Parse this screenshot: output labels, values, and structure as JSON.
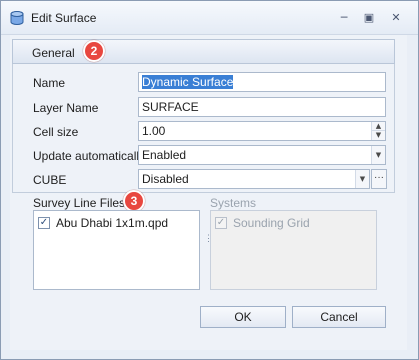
{
  "window": {
    "title": "Edit Surface",
    "controls": {
      "minimize": "─",
      "maximize": "▣",
      "close": "✕"
    }
  },
  "general": {
    "header": "General",
    "badge": "2",
    "fields": {
      "name": {
        "label": "Name",
        "value": "Dynamic Surface"
      },
      "layer_name": {
        "label": "Layer Name",
        "value": "SURFACE"
      },
      "cell_size": {
        "label": "Cell size",
        "value": "1.00"
      },
      "update_automatically": {
        "label": "Update automatically",
        "value": "Enabled"
      },
      "cube": {
        "label": "CUBE",
        "value": "Disabled",
        "ellipsis": "···"
      }
    }
  },
  "survey_line_files": {
    "title": "Survey Line Files",
    "badge": "3",
    "items": [
      {
        "label": "Abu Dhabi 1x1m.qpd",
        "checked": true
      }
    ]
  },
  "systems": {
    "title": "Systems",
    "items": [
      {
        "label": "Sounding Grid",
        "checked": true,
        "enabled": false
      }
    ]
  },
  "buttons": {
    "ok": "OK",
    "cancel": "Cancel"
  },
  "icons": {
    "check": "✓",
    "spin_up": "▲",
    "spin_down": "▼",
    "dropdown": "▼",
    "splitter": "⋮"
  },
  "colors": {
    "badge": "#e8473f",
    "selection": "#3a7fd5",
    "window_bg": "#eef2f8"
  }
}
